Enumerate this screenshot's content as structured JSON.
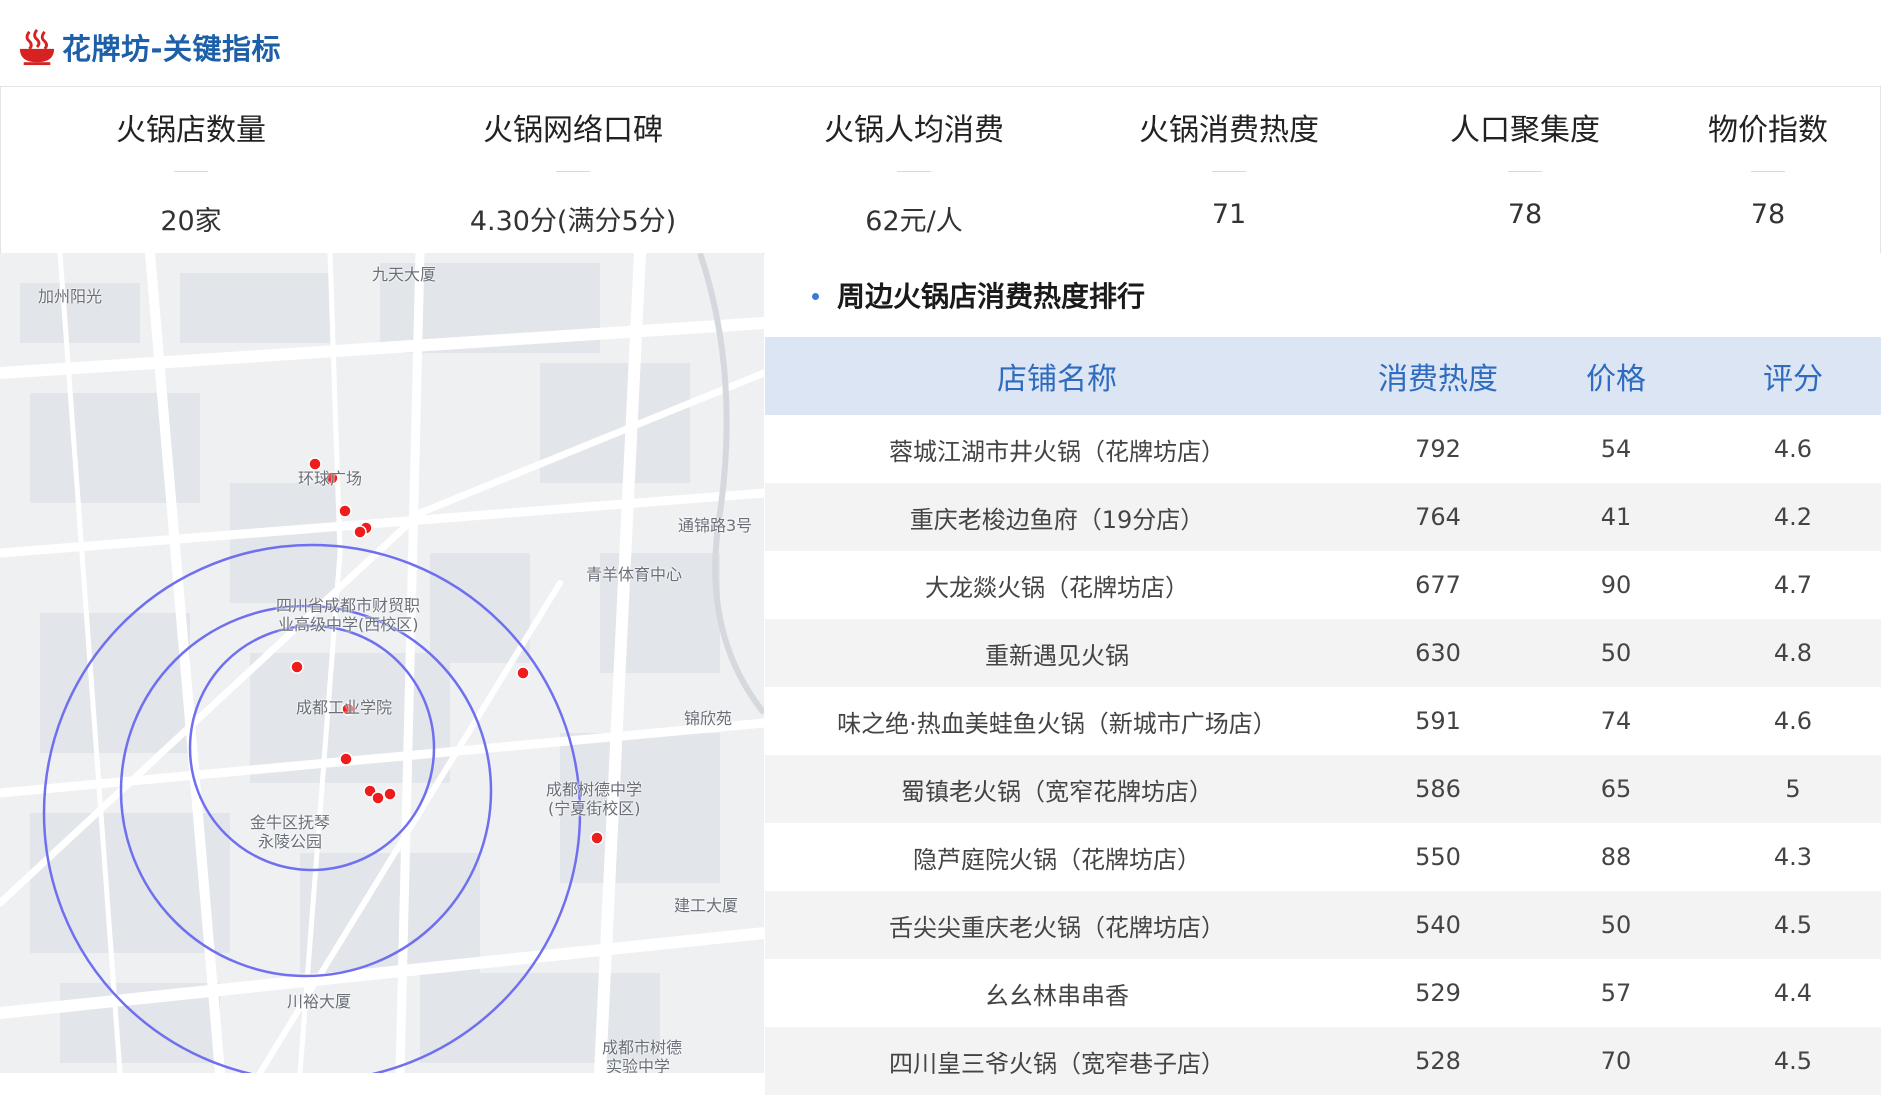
{
  "header": {
    "title": "花牌坊-关键指标",
    "logo_icon": "hotpot-logo-icon",
    "accent_color": "#1d5fa8",
    "logo_color": "#d62222"
  },
  "kpis": [
    {
      "label": "火锅店数量",
      "value": "20家"
    },
    {
      "label": "火锅网络口碑",
      "value": "4.30分(满分5分)"
    },
    {
      "label": "火锅人均消费",
      "value": "62元/人"
    },
    {
      "label": "火锅消费热度",
      "value": "71"
    },
    {
      "label": "人口聚集度",
      "value": "78"
    },
    {
      "label": "物价指数",
      "value": "78"
    }
  ],
  "map": {
    "ring_color": "#6f6ff0",
    "marker_color": "#ee1c1c",
    "labels": [
      {
        "text": "加州阳光"
      },
      {
        "text": "九天大厦"
      },
      {
        "text": "环球广场"
      },
      {
        "text": "通锦路3号"
      },
      {
        "text": "青羊体育中心"
      },
      {
        "text": "四川省成都市财贸职"
      },
      {
        "text": "业高级中学(西校区)"
      },
      {
        "text": "成都工业学院"
      },
      {
        "text": "锦欣苑"
      },
      {
        "text": "成都树德中学"
      },
      {
        "text": "(宁夏街校区)"
      },
      {
        "text": "金牛区抚琴"
      },
      {
        "text": "永陵公园"
      },
      {
        "text": "建工大厦"
      },
      {
        "text": "川裕大厦"
      },
      {
        "text": "成都市树德"
      },
      {
        "text": "实验中学"
      }
    ]
  },
  "ranking": {
    "title": "周边火锅店消费热度排行",
    "columns": [
      "店铺名称",
      "消费热度",
      "价格",
      "评分"
    ],
    "rows": [
      {
        "name": "蓉城江湖市井火锅（花牌坊店）",
        "heat": "792",
        "price": "54",
        "score": "4.6"
      },
      {
        "name": "重庆老梭边鱼府（19分店）",
        "heat": "764",
        "price": "41",
        "score": "4.2"
      },
      {
        "name": "大龙燚火锅（花牌坊店）",
        "heat": "677",
        "price": "90",
        "score": "4.7"
      },
      {
        "name": "重新遇见火锅",
        "heat": "630",
        "price": "50",
        "score": "4.8"
      },
      {
        "name": "味之绝·热血美蛙鱼火锅（新城市广场店）",
        "heat": "591",
        "price": "74",
        "score": "4.6"
      },
      {
        "name": "蜀镇老火锅（宽窄花牌坊店）",
        "heat": "586",
        "price": "65",
        "score": "5"
      },
      {
        "name": "隐芦庭院火锅（花牌坊店）",
        "heat": "550",
        "price": "88",
        "score": "4.3"
      },
      {
        "name": "舌尖尖重庆老火锅（花牌坊店）",
        "heat": "540",
        "price": "50",
        "score": "4.5"
      },
      {
        "name": "幺幺林串串香",
        "heat": "529",
        "price": "57",
        "score": "4.4"
      },
      {
        "name": "四川皇三爷火锅（宽窄巷子店）",
        "heat": "528",
        "price": "70",
        "score": "4.5"
      }
    ]
  }
}
